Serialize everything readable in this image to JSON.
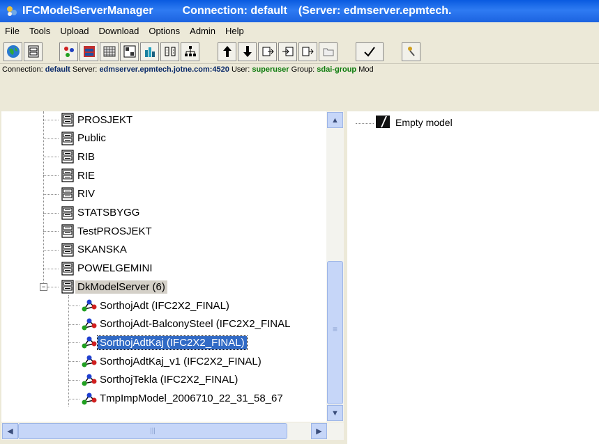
{
  "window": {
    "app_name": "IFCModelServerManager",
    "connection_title": "Connection: default",
    "server_title": "(Server: edmserver.epmtech."
  },
  "menu": [
    "File",
    "Tools",
    "Upload",
    "Download",
    "Options",
    "Admin",
    "Help"
  ],
  "toolbar": {
    "icons": [
      "globe-icon",
      "server-icon",
      "models-icon",
      "database-icon",
      "calendar-icon",
      "schema-icon",
      "chart-icon",
      "compare-icon",
      "hierarchy-icon",
      "arrow-up-icon",
      "arrow-down-icon",
      "export-icon",
      "import-icon",
      "move-icon",
      "folder-icon",
      "checkmark-icon",
      "tools-icon"
    ]
  },
  "status": {
    "connection_label": "Connection:",
    "connection_value": "default",
    "server_label": "Server:",
    "server_value": "edmserver.epmtech.jotne.com:4520",
    "user_label": "User:",
    "user_value": "superuser",
    "group_label": "Group:",
    "group_value": "sdai-group",
    "trailing": "Mod"
  },
  "tree": {
    "groups": [
      "PROSJEKT",
      "Public",
      "RIB",
      "RIE",
      "RIV",
      "STATSBYGG",
      "TestPROSJEKT",
      "SKANSKA",
      "POWELGEMINI"
    ],
    "expanded_group": "DkModelServer (6)",
    "expander_symbol": "−",
    "models": [
      "SorthojAdt (IFC2X2_FINAL)",
      "SorthojAdt-BalconySteel (IFC2X2_FINAL",
      "SorthojAdtKaj (IFC2X2_FINAL)",
      "SorthojAdtKaj_v1 (IFC2X2_FINAL)",
      "SorthojTekla (IFC2X2_FINAL)",
      "TmpImpModel_2006710_22_31_58_67"
    ],
    "selected_model": "SorthojAdtKaj (IFC2X2_FINAL)"
  },
  "scroll": {
    "up": "▲",
    "down": "▼",
    "left": "◀",
    "right": "▶",
    "grip_v": "≡",
    "grip_h": "|||"
  },
  "right": {
    "item": "Empty model"
  },
  "colors": {
    "title": "#0A5BE0",
    "selection": "#316AC5",
    "user": "#0a7a0a",
    "server": "#0a2a6a"
  }
}
